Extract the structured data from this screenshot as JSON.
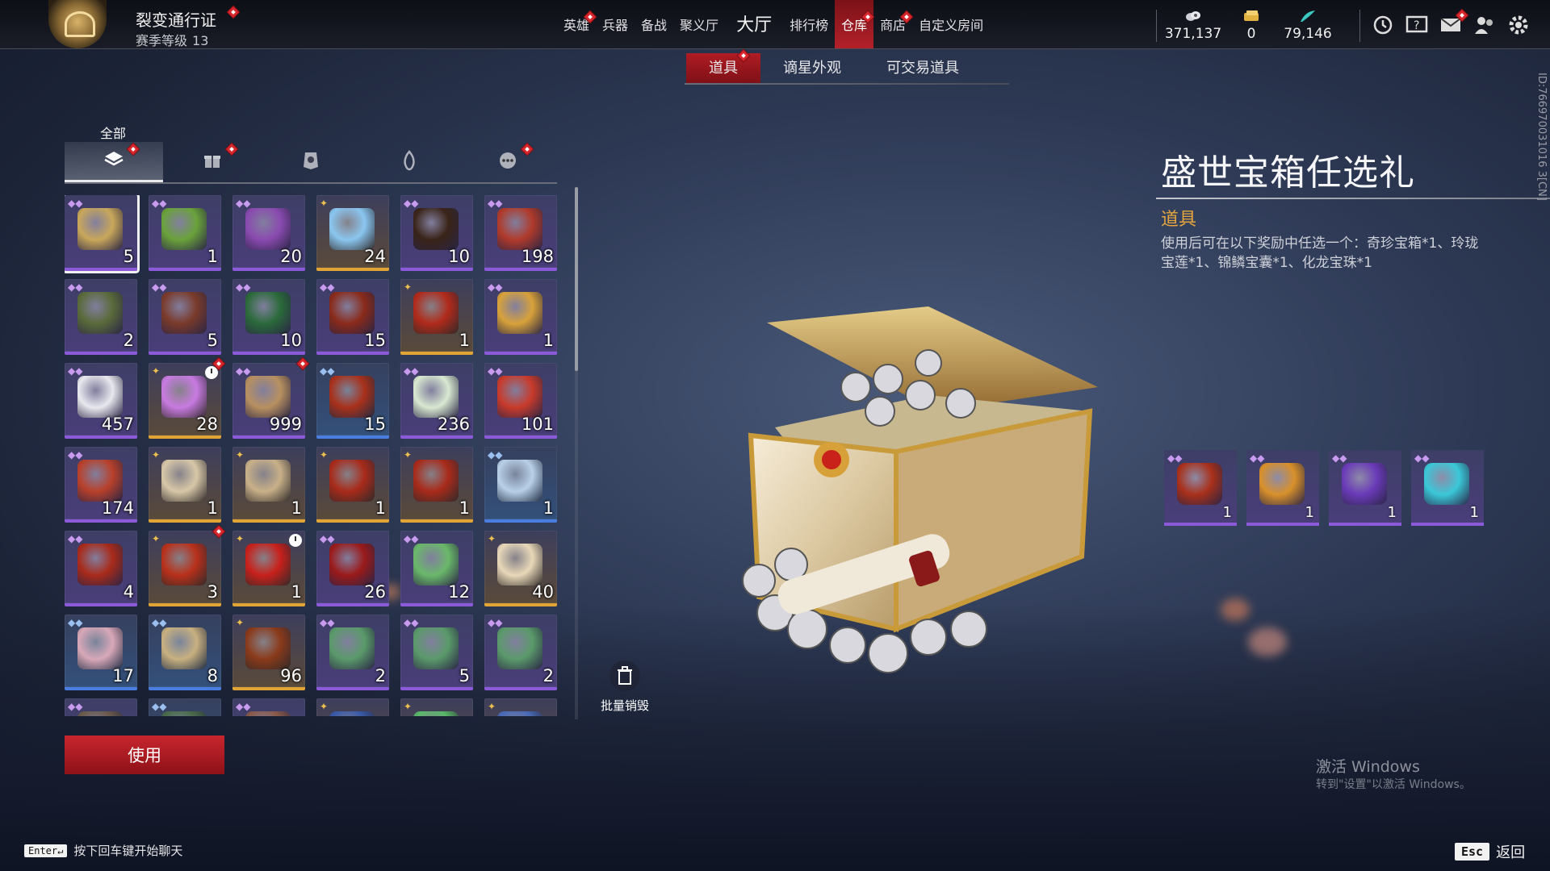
{
  "pass": {
    "title": "裂变通行证",
    "level_label": "赛季等级",
    "level": "13"
  },
  "nav": [
    {
      "label": "英雄",
      "dot": true
    },
    {
      "label": "兵器",
      "dot": false
    },
    {
      "label": "备战",
      "dot": false
    },
    {
      "label": "聚义厅",
      "dot": false
    },
    {
      "label": "大厅",
      "dot": false,
      "big": true
    },
    {
      "label": "排行榜",
      "dot": false
    },
    {
      "label": "仓库",
      "dot": true,
      "active": true
    },
    {
      "label": "商店",
      "dot": true
    },
    {
      "label": "自定义房间",
      "dot": false
    }
  ],
  "currencies": [
    {
      "icon": "coin-pile-icon",
      "value": "371,137"
    },
    {
      "icon": "gold-ticket-icon",
      "value": "0"
    },
    {
      "icon": "jade-feather-icon",
      "value": "79,146"
    }
  ],
  "top_icons": [
    "timer-icon",
    "help-icon",
    "mail-icon",
    "friends-icon",
    "settings-icon"
  ],
  "subtabs": [
    {
      "label": "道具",
      "active": true,
      "dot": true
    },
    {
      "label": "谪星外观",
      "active": false,
      "dot": false
    },
    {
      "label": "可交易道具",
      "active": false,
      "dot": false
    }
  ],
  "category": {
    "label": "全部",
    "tabs": [
      {
        "icon": "layers-icon",
        "active": true,
        "dot": true
      },
      {
        "icon": "gift-icon",
        "active": false,
        "dot": true
      },
      {
        "icon": "badge-icon",
        "active": false,
        "dot": false
      },
      {
        "icon": "flame-icon",
        "active": false,
        "dot": false
      },
      {
        "icon": "more-icon",
        "active": false,
        "dot": true
      }
    ]
  },
  "items": [
    {
      "qty": "5",
      "rarity": "purple",
      "color": "#c9a75a",
      "selected": true
    },
    {
      "qty": "1",
      "rarity": "purple",
      "color": "#6aa23a"
    },
    {
      "qty": "20",
      "rarity": "purple",
      "color": "#8a4ab0"
    },
    {
      "qty": "24",
      "rarity": "gold",
      "color": "#8ac6f0"
    },
    {
      "qty": "10",
      "rarity": "purple",
      "color": "#3a2418"
    },
    {
      "qty": "198",
      "rarity": "purple",
      "color": "#b03a2a"
    },
    {
      "qty": "2",
      "rarity": "purple",
      "color": "#5a6a3a"
    },
    {
      "qty": "5",
      "rarity": "purple",
      "color": "#7a3a2a"
    },
    {
      "qty": "10",
      "rarity": "purple",
      "color": "#2a6a3a"
    },
    {
      "qty": "15",
      "rarity": "purple",
      "color": "#8a2a1a"
    },
    {
      "qty": "1",
      "rarity": "gold",
      "color": "#b02a1a"
    },
    {
      "qty": "1",
      "rarity": "purple",
      "color": "#d8a23a"
    },
    {
      "qty": "457",
      "rarity": "purple",
      "color": "#e8e8ee"
    },
    {
      "qty": "28",
      "rarity": "gold",
      "color": "#c87ae0",
      "clock": true,
      "dot": true
    },
    {
      "qty": "999",
      "rarity": "purple",
      "color": "#b89060",
      "dot": true
    },
    {
      "qty": "15",
      "rarity": "blue",
      "color": "#a8301a"
    },
    {
      "qty": "236",
      "rarity": "purple",
      "color": "#d8e8d0"
    },
    {
      "qty": "101",
      "rarity": "purple",
      "color": "#c83a2a"
    },
    {
      "qty": "174",
      "rarity": "purple",
      "color": "#b8402a"
    },
    {
      "qty": "1",
      "rarity": "gold",
      "color": "#d8c8a8"
    },
    {
      "qty": "1",
      "rarity": "gold",
      "color": "#c8b088"
    },
    {
      "qty": "1",
      "rarity": "gold",
      "color": "#a82a1a"
    },
    {
      "qty": "1",
      "rarity": "gold",
      "color": "#a82a1a"
    },
    {
      "qty": "1",
      "rarity": "blue",
      "color": "#b8d0e8"
    },
    {
      "qty": "4",
      "rarity": "purple",
      "color": "#a82a1a"
    },
    {
      "qty": "3",
      "rarity": "gold",
      "color": "#b8301a",
      "dot": true
    },
    {
      "qty": "1",
      "rarity": "gold",
      "color": "#c8201a",
      "clock": true
    },
    {
      "qty": "26",
      "rarity": "purple",
      "color": "#9a1a1a"
    },
    {
      "qty": "12",
      "rarity": "purple",
      "color": "#6ab86a"
    },
    {
      "qty": "40",
      "rarity": "gold",
      "color": "#e8d8b8"
    },
    {
      "qty": "17",
      "rarity": "blue",
      "color": "#d8a8b8"
    },
    {
      "qty": "8",
      "rarity": "blue",
      "color": "#c8b080"
    },
    {
      "qty": "96",
      "rarity": "gold",
      "color": "#8a3a1a"
    },
    {
      "qty": "2",
      "rarity": "purple",
      "color": "#5a9a6a"
    },
    {
      "qty": "5",
      "rarity": "purple",
      "color": "#5a9a6a"
    },
    {
      "qty": "2",
      "rarity": "purple",
      "color": "#5a9a6a"
    },
    {
      "qty": "",
      "rarity": "purple",
      "color": "#6a5a4a"
    },
    {
      "qty": "",
      "rarity": "blue",
      "color": "#4a6a4a"
    },
    {
      "qty": "",
      "rarity": "purple",
      "color": "#8a5a4a"
    },
    {
      "qty": "",
      "rarity": "gold",
      "color": "#3a5aa8"
    },
    {
      "qty": "",
      "rarity": "gold",
      "color": "#5ab86a"
    },
    {
      "qty": "",
      "rarity": "gold",
      "color": "#4a6ab8"
    }
  ],
  "actions": {
    "use": "使用",
    "bulk_destroy": "批量销毁"
  },
  "detail": {
    "title": "盛世宝箱任选礼",
    "category": "道具",
    "description": "使用后可在以下奖励中任选一个：奇珍宝箱*1、玲珑宝莲*1、锦鳞宝囊*1、化龙宝珠*1",
    "rewards": [
      {
        "qty": "1",
        "color": "#a8301a",
        "icon": "treasure-chest-icon"
      },
      {
        "qty": "1",
        "color": "#d8902a",
        "icon": "lotus-icon"
      },
      {
        "qty": "1",
        "color": "#6a3ab8",
        "icon": "pouch-icon"
      },
      {
        "qty": "1",
        "color": "#3ac8d8",
        "icon": "dragon-orb-icon"
      }
    ]
  },
  "player_id": "ID:766970031016 3[CN]",
  "watermark": {
    "title": "激活 Windows",
    "sub": "转到\"设置\"以激活 Windows。"
  },
  "chat_hint": {
    "key": "Enter↵",
    "text": "按下回车键开始聊天"
  },
  "esc": {
    "key": "Esc",
    "label": "返回"
  }
}
